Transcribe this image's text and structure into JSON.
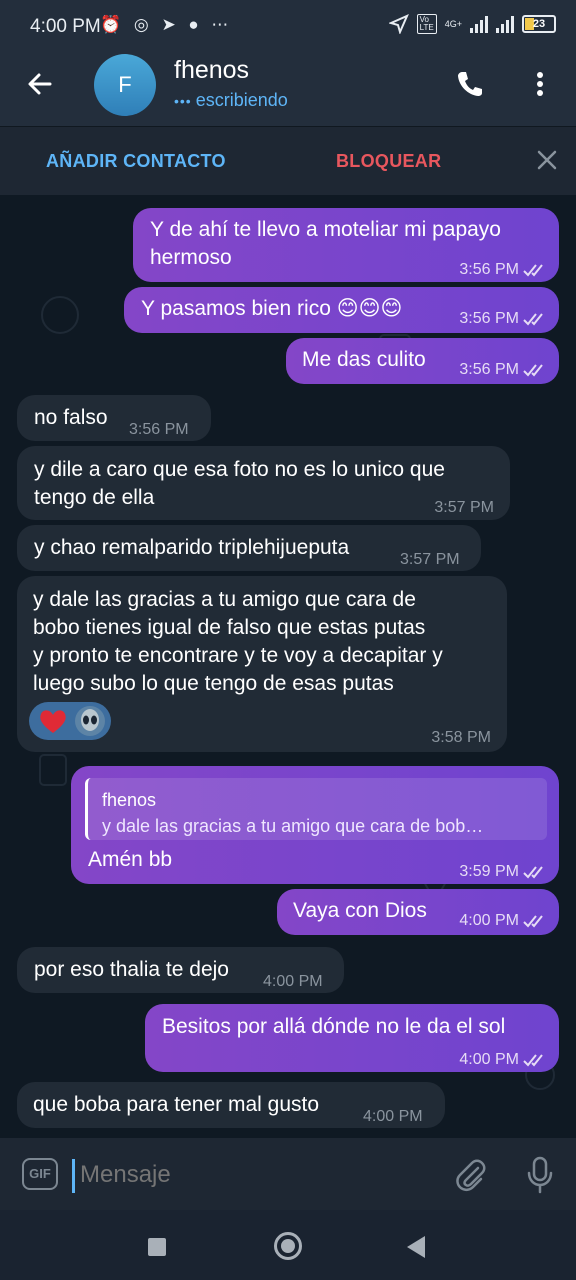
{
  "status_bar": {
    "time": "4:00 PM",
    "left_icons": "⏰ ◎ ➤ ● ⋯",
    "network": "4G+",
    "battery": "23"
  },
  "header": {
    "avatar_letter": "F",
    "contact_name": "fhenos",
    "status": "escribiendo",
    "accent_color": "#5eb5f7"
  },
  "actions": {
    "add_contact": "AÑADIR CONTACTO",
    "block": "BLOQUEAR"
  },
  "messages": [
    {
      "dir": "out",
      "lines": [
        "Y de ahí te llevo a moteliar mi papayo",
        "hermoso"
      ],
      "time": "3:56 PM"
    },
    {
      "dir": "out",
      "lines": [
        "Y pasamos bien rico 😊😊😊"
      ],
      "time": "3:56 PM"
    },
    {
      "dir": "out",
      "lines": [
        "Me das culito"
      ],
      "time": "3:56 PM"
    },
    {
      "dir": "in",
      "lines": [
        "no falso"
      ],
      "time": "3:56 PM"
    },
    {
      "dir": "in",
      "lines": [
        "y dile a caro que esa foto no es lo unico que",
        "tengo de ella"
      ],
      "time": "3:57 PM"
    },
    {
      "dir": "in",
      "lines": [
        "y chao remalparido triplehijueputa"
      ],
      "time": "3:57 PM"
    },
    {
      "dir": "in",
      "lines": [
        "y dale las gracias a tu amigo que cara de",
        "bobo tienes igual de falso que estas putas",
        "y pronto te encontrare y te voy a decapitar y",
        "luego subo lo que tengo de esas putas"
      ],
      "time": "3:58 PM",
      "reactions": [
        "heart",
        "alien"
      ]
    },
    {
      "dir": "out",
      "reply_name": "fhenos",
      "reply_text": "y dale las gracias a tu amigo que cara de bob…",
      "lines": [
        "Amén bb"
      ],
      "time": "3:59 PM"
    },
    {
      "dir": "out",
      "lines": [
        "Vaya con Dios"
      ],
      "time": "4:00 PM"
    },
    {
      "dir": "in",
      "lines": [
        "por eso thalia te dejo"
      ],
      "time": "4:00 PM"
    },
    {
      "dir": "out",
      "lines": [
        "Besitos por allá dónde no le da el sol"
      ],
      "time": "4:00 PM"
    },
    {
      "dir": "in",
      "lines": [
        "que boba para tener mal gusto"
      ],
      "time": "4:00 PM"
    }
  ],
  "input": {
    "placeholder": "Mensaje",
    "gif_label": "GIF"
  },
  "colors": {
    "outgoing_bubble": "#7b42c9",
    "incoming_bubble": "#212b36",
    "block_red": "#e8575e"
  }
}
